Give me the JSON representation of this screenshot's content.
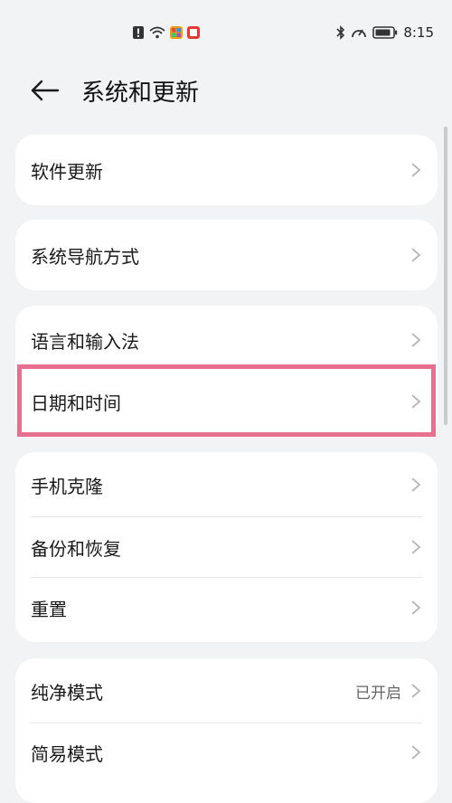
{
  "status_bar": {
    "time": "8:15",
    "left_icons": [
      "notification-alert-icon",
      "wifi-icon",
      "app-grid-icon",
      "app-red-icon"
    ],
    "right_icons": [
      "bluetooth-icon",
      "speedometer-icon",
      "battery-icon"
    ]
  },
  "header": {
    "title": "系统和更新",
    "back_icon": "arrow-left-icon"
  },
  "groups": [
    {
      "items": [
        {
          "label": "软件更新",
          "value": ""
        }
      ]
    },
    {
      "items": [
        {
          "label": "系统导航方式",
          "value": ""
        }
      ]
    },
    {
      "items": [
        {
          "label": "语言和输入法",
          "value": ""
        },
        {
          "label": "日期和时间",
          "value": ""
        }
      ]
    },
    {
      "items": [
        {
          "label": "手机克隆",
          "value": ""
        },
        {
          "label": "备份和恢复",
          "value": ""
        },
        {
          "label": "重置",
          "value": ""
        }
      ]
    },
    {
      "items": [
        {
          "label": "纯净模式",
          "value": "已开启"
        },
        {
          "label": "简易模式",
          "value": ""
        }
      ]
    }
  ],
  "colors": {
    "background": "#f1f3f5",
    "card": "#ffffff",
    "highlight": "#e8708f",
    "chevron": "#b3b3b3"
  }
}
